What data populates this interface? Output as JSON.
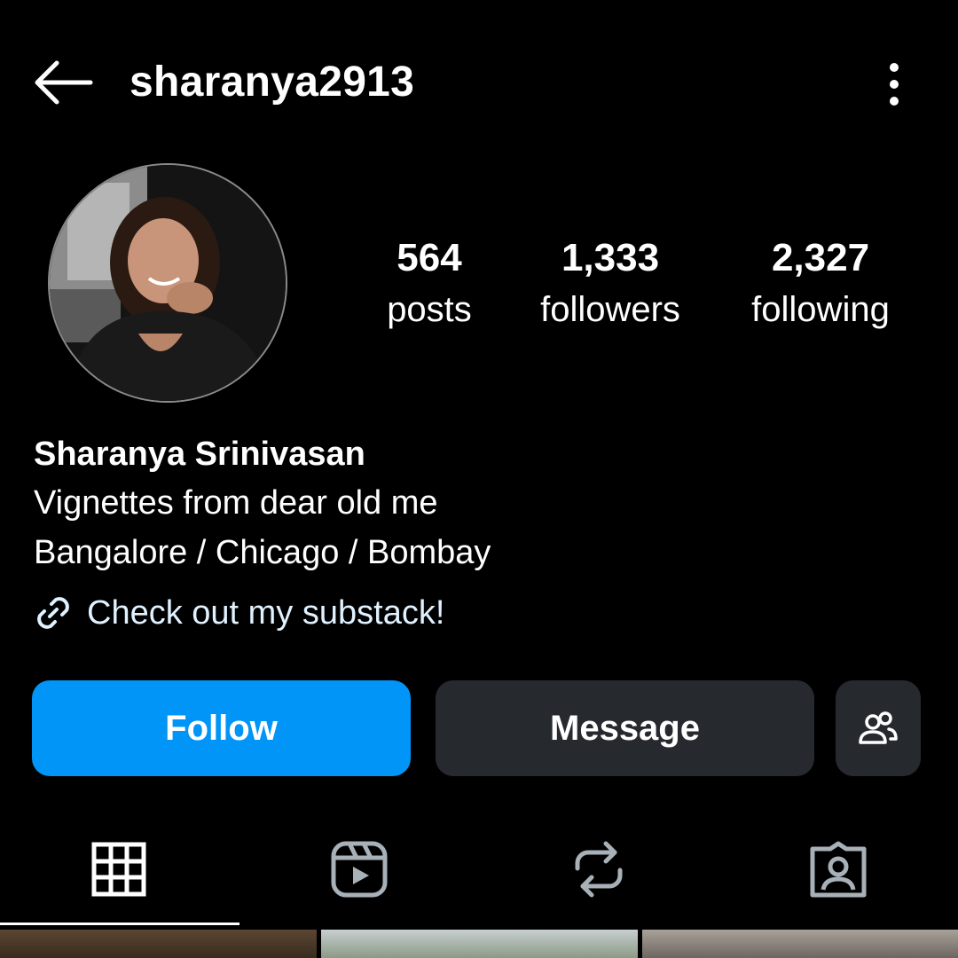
{
  "header": {
    "username": "sharanya2913",
    "back_icon": "arrow-left-icon",
    "more_icon": "more-vertical-icon"
  },
  "profile": {
    "avatar_description_icon": "profile-photo",
    "stats": {
      "posts": {
        "value": "564",
        "label": "posts"
      },
      "followers": {
        "value": "1,333",
        "label": "followers"
      },
      "following": {
        "value": "2,327",
        "label": "following"
      }
    },
    "full_name": "Sharanya Srinivasan",
    "bio_lines": [
      "Vignettes from dear old me",
      "Bangalore / Chicago / Bombay"
    ],
    "link_text": "Check out my substack!",
    "link_icon": "link-icon"
  },
  "actions": {
    "follow_label": "Follow",
    "message_label": "Message",
    "suggest_icon": "add-people-icon"
  },
  "tabs": [
    {
      "name": "grid",
      "icon": "grid-icon",
      "active": true
    },
    {
      "name": "reels",
      "icon": "reels-icon",
      "active": false
    },
    {
      "name": "reposts",
      "icon": "repost-icon",
      "active": false
    },
    {
      "name": "tagged",
      "icon": "tagged-icon",
      "active": false
    }
  ],
  "colors": {
    "background": "#000000",
    "follow_button": "#0095f6",
    "secondary_button": "#262a2f",
    "link_text": "#e0f1ff"
  }
}
